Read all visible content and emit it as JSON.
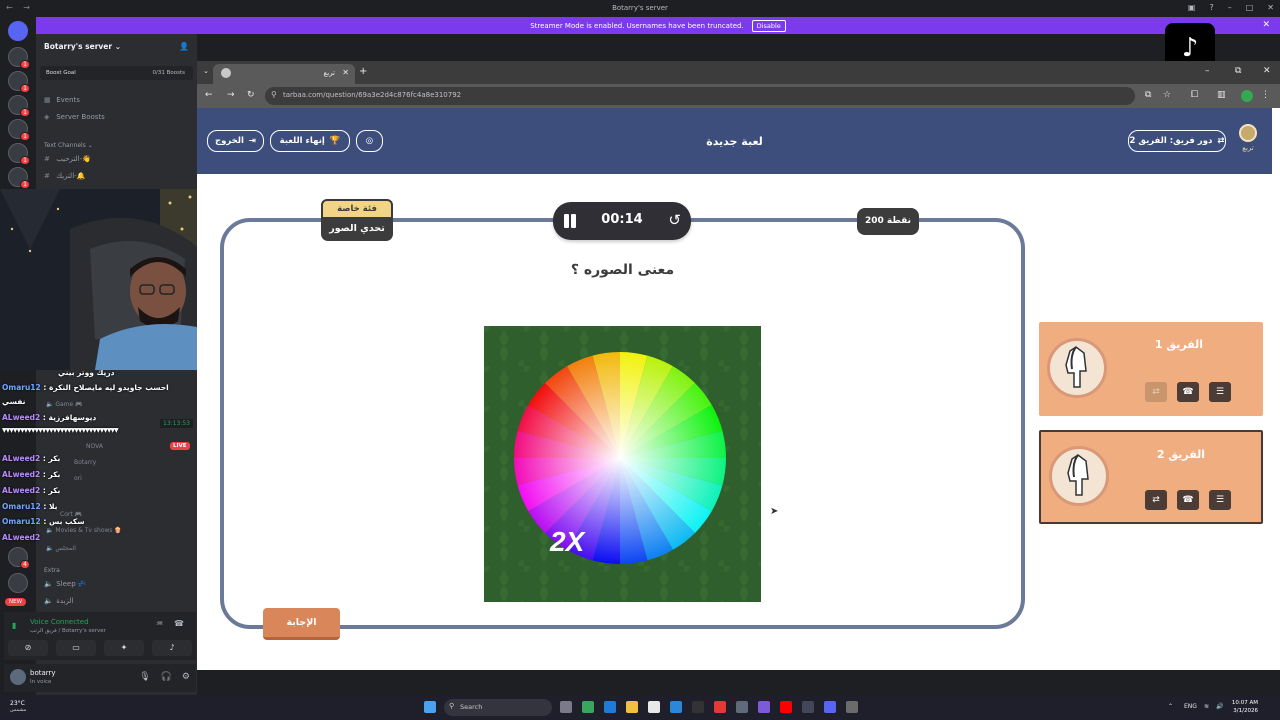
{
  "window": {
    "title": "Botarry's server"
  },
  "banner": {
    "text": "Streamer Mode is enabled. Usernames have been truncated.",
    "action": "Disable"
  },
  "discord": {
    "server_name": "Botarry's server",
    "boost": {
      "label": "Boost Goal",
      "progress": "0/31 Boosts"
    },
    "items": [
      {
        "label": "Events",
        "icon": "calendar-icon"
      },
      {
        "label": "Server Boosts",
        "icon": "boost-icon"
      }
    ],
    "text_category": "Text Channels",
    "text_channels": [
      "الترحيب-👋",
      "التريك-🔔"
    ],
    "voice_channels": [
      {
        "label": "Game 🎮"
      },
      {
        "label": "Movies & Tv shows 🍿"
      },
      {
        "label": "المجلس"
      }
    ],
    "voice_members": [
      "NOVA",
      "Botarry",
      "ori",
      "Cort 🎮"
    ],
    "extra_category": "Extra",
    "extra_channels": [
      "Sleep 💤",
      "الزبدة"
    ],
    "voice_status": {
      "title": "Voice Connected",
      "sub": "فريق الرتب / Botarry's server"
    },
    "user": {
      "name": "botarry",
      "status": "In voice"
    },
    "live_badge": "LIVE",
    "new_badge": "NEW",
    "chat_time": "13:13:53"
  },
  "chat": [
    {
      "user": "",
      "text": "دريك ووتر بيني"
    },
    {
      "user": "Omaru12",
      "text": "احسب جاويدو ليه مايصلاح النكرة"
    },
    {
      "user": "",
      "text": "نفسي"
    },
    {
      "user": "ALweed2",
      "text": "ديوسهافرزية"
    },
    {
      "user": "",
      "text": "▼▼▼▼▼▼▼▼▼▼▼▼▼▼▼▼▼▼▼▼▼▼▼▼▼▼▼▼▼▼▼▼"
    },
    {
      "user": "ALweed2",
      "text": "بكر"
    },
    {
      "user": "ALweed2",
      "text": "بكر"
    },
    {
      "user": "ALweed2",
      "text": "بكر"
    },
    {
      "user": "Omaru12",
      "text": "بلا"
    },
    {
      "user": "Omaru12",
      "text": "سكب بس"
    },
    {
      "user": "ALweed2",
      "text": ""
    }
  ],
  "browser": {
    "tab_title": "تربع",
    "url": "tarbaa.com/question/69a3e2d4c876fc4a8e310792"
  },
  "game": {
    "header": {
      "exit": "الخروج",
      "end_game": "إنهاء اللعبة",
      "title": "لعبة جديدة",
      "turn": "دور فريق: الفريق 2",
      "logo_text": "تربع"
    },
    "category": {
      "top": "فئة خاصة",
      "bottom": "تحدي الصور"
    },
    "timer": "00:14",
    "points": "200 نقطة",
    "question": "معنى الصوره ؟",
    "image_label": "2X",
    "answer_button": "الإجابة",
    "teams": [
      {
        "name": "الفريق 1",
        "active": false
      },
      {
        "name": "الفريق 2",
        "active": true
      }
    ]
  },
  "taskbar": {
    "weather": "23°C",
    "weather_sub": "مشمس",
    "search": "Search",
    "lang": "ENG",
    "time": "10:07 AM",
    "date": "3/1/2026"
  }
}
